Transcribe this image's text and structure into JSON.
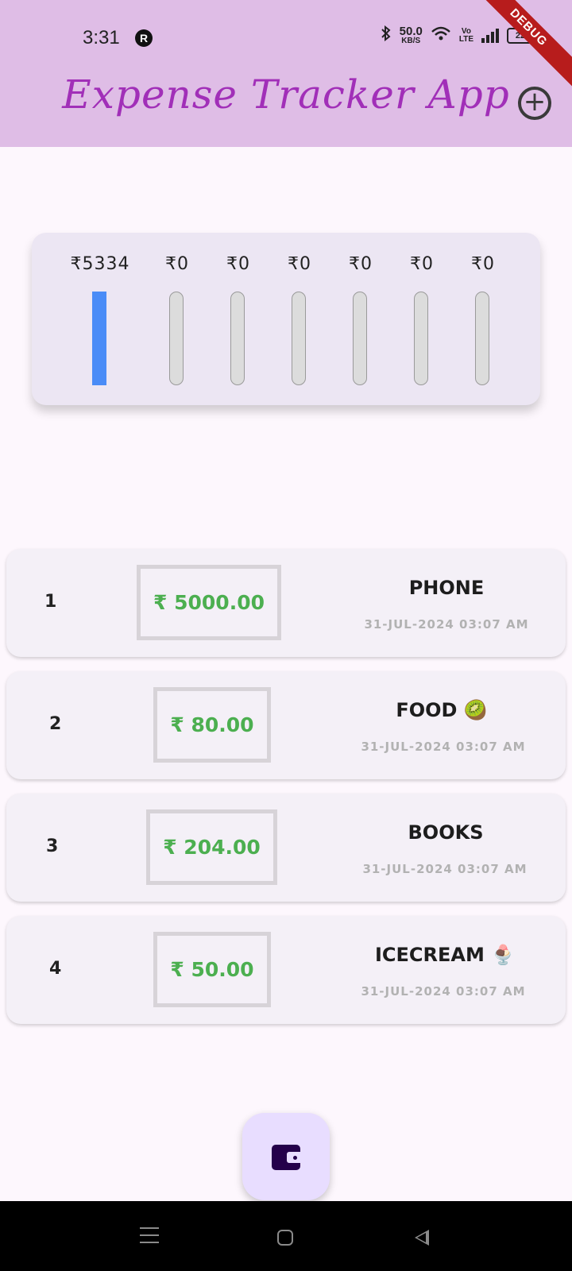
{
  "status_bar": {
    "time": "3:31",
    "app_icon_letter": "R",
    "network_speed_value": "50.0",
    "network_speed_unit": "KB/S",
    "volte_label_top": "Vo",
    "volte_label_bottom": "LTE",
    "battery_level": "22",
    "bluetooth_icon": "bluetooth-icon",
    "wifi_icon": "wifi-icon"
  },
  "debug_banner": "DEBUG",
  "app_bar": {
    "title": "Expense Tracker App",
    "add_icon": "add-circle-icon"
  },
  "chart_data": {
    "type": "bar",
    "categories": [
      "",
      "",
      "",
      "",
      "",
      "",
      ""
    ],
    "value_labels": [
      "₹5334",
      "₹0",
      "₹0",
      "₹0",
      "₹0",
      "₹0",
      "₹0"
    ],
    "values": [
      5334,
      0,
      0,
      0,
      0,
      0,
      0
    ],
    "fill_fraction": [
      1,
      0,
      0,
      0,
      0,
      0,
      0
    ],
    "title": "",
    "xlabel": "",
    "ylabel": "",
    "ylim": [
      0,
      5334
    ],
    "bar_color": "#4a8cf7",
    "track_color": "#dcdcdc",
    "grid": false
  },
  "expenses": [
    {
      "index": "1",
      "amount": "₹ 5000.00",
      "title": "PHONE",
      "date": "31-JUL-2024 03:07 AM"
    },
    {
      "index": "2",
      "amount": "₹ 80.00",
      "title": "FOOD 🥝",
      "date": "31-JUL-2024 03:07 AM"
    },
    {
      "index": "3",
      "amount": "₹ 204.00",
      "title": "BOOKS",
      "date": "31-JUL-2024 03:07 AM"
    },
    {
      "index": "4",
      "amount": "₹ 50.00",
      "title": "ICECREAM 🍨",
      "date": "31-JUL-2024 03:07 AM"
    }
  ],
  "fab": {
    "icon": "wallet-icon"
  },
  "nav_bar": {
    "icons": [
      "menu-icon",
      "home-icon",
      "back-icon"
    ]
  },
  "colors": {
    "app_bar": "#dfbde6",
    "title": "#a12fb8",
    "amount": "#4caf50",
    "fab": "#e8ddff"
  }
}
